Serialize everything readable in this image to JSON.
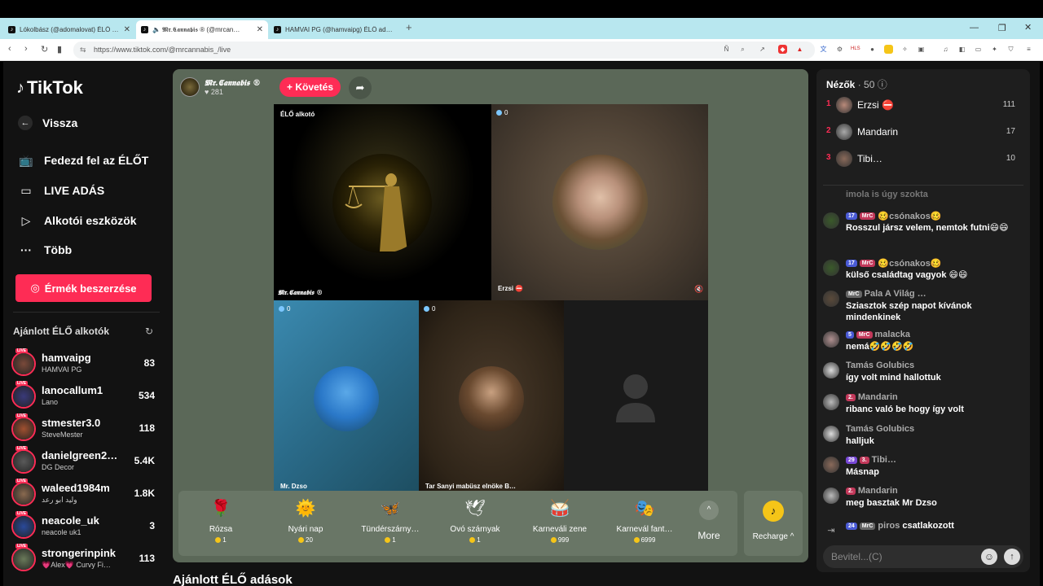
{
  "browser": {
    "tabs": [
      {
        "label": "Lókolbász (@adomalovat) ÉLŐ adás…",
        "active": false
      },
      {
        "label": "🔈 𝕸𝖗.𝕮𝖆𝖓𝖓𝖆𝖇𝖎𝖘 ® (@mrcan…",
        "active": true
      },
      {
        "label": "HAMVAI PG (@hamvaipg) ÉLŐ adás…",
        "active": false
      }
    ],
    "new_tab": "+",
    "url": "https://www.tiktok.com/@mrcannabis_/live"
  },
  "sidebar": {
    "logo": "TikTok",
    "back": "Vissza",
    "nav": [
      {
        "label": "Fedezd fel az ÉLŐT",
        "icon": "explore-live-icon"
      },
      {
        "label": "LIVE ADÁS",
        "icon": "camera-icon"
      },
      {
        "label": "Alkotói eszközök",
        "icon": "creator-tools-icon"
      },
      {
        "label": "Több",
        "icon": "more-dots-icon"
      }
    ],
    "coin_button": "Érmék beszerzése",
    "recommended_title": "Ajánlott ÉLŐ alkotók",
    "live_tag": "LIVE",
    "recommended": [
      {
        "name": "hamvaipg",
        "sub": "HAMVAI PG",
        "count": "83",
        "color": "#7a4a3a"
      },
      {
        "name": "lanocallum1",
        "sub": "Lano",
        "count": "534",
        "color": "#3a3a7a"
      },
      {
        "name": "stmester3.0",
        "sub": "SteveMester",
        "count": "118",
        "color": "#a05030"
      },
      {
        "name": "danielgreen2…",
        "sub": "DG Decor",
        "count": "5.4K",
        "color": "#5a5a5a"
      },
      {
        "name": "waleed1984m",
        "sub": "وليد ابو رعد",
        "count": "1.8K",
        "color": "#8a6a50"
      },
      {
        "name": "neacole_uk",
        "sub": "neacole uk1",
        "count": "3",
        "color": "#2a4a9a"
      },
      {
        "name": "strongerinpink",
        "sub": "💗Alex💗 Curvy Fi…",
        "count": "113",
        "color": "#6a7a5a"
      }
    ]
  },
  "stream": {
    "host_name": "𝕸𝖗.𝕮𝖆𝖓𝖓𝖆𝖇𝖎𝖘 ®",
    "host_likes": "♥ 281",
    "follow": "+ Követés",
    "tiles": {
      "host_badge": "ÉLŐ alkotó",
      "host_label": "𝕸𝖗.𝕮𝖆𝖓𝖓𝖆𝖇𝖎𝖘 ®",
      "erzsi_count": "0",
      "erzsi_label": "Erzsi ⛔",
      "dzso_count": "0",
      "dzso_label": "Mr. Dzso",
      "tar_count": "0",
      "tar_label": "Tar Sanyi mabüsz elnöke B…"
    },
    "gifts": [
      {
        "name": "Rózsa",
        "price": "1",
        "icon": "🌹"
      },
      {
        "name": "Nyári nap",
        "price": "20",
        "icon": "🌞"
      },
      {
        "name": "Tündérszárny…",
        "price": "1",
        "icon": "🦋"
      },
      {
        "name": "Óvó szárnyak",
        "price": "1",
        "icon": "🕊"
      },
      {
        "name": "Karneváli zene",
        "price": "999",
        "icon": "🥁"
      },
      {
        "name": "Karnevál fant…",
        "price": "6999",
        "icon": "🎭"
      }
    ],
    "more": "More",
    "recharge": "Recharge ^"
  },
  "recommended_live_title": "Ajánlott ÉLŐ adások",
  "right": {
    "viewers_title": "Nézők",
    "viewers_count": "· 50",
    "top_viewers": [
      {
        "rank": "1",
        "name": "Erzsi ⛔",
        "score": "111",
        "color": "#b98a7a"
      },
      {
        "rank": "2",
        "name": "Mandarin",
        "score": "17",
        "color": "#aaaaaa"
      },
      {
        "rank": "3",
        "name": "Tibi…",
        "score": "10",
        "color": "#8a6a5a"
      }
    ],
    "messages": [
      {
        "user": "imola is úgy szokta",
        "text": "",
        "badges": [],
        "color": "#555"
      },
      {
        "user": "🥴csónakos🥴",
        "text": "Rosszul jársz velem, nemtok futni😄😄",
        "badges": [
          {
            "t": "17",
            "c": "b-blue"
          },
          {
            "t": "MrC",
            "c": "b-red"
          }
        ],
        "color": "#3a5a2a"
      },
      {
        "user": "🥴csónakos🥴",
        "text": "külső családtag vagyok 😄😄",
        "badges": [
          {
            "t": "17",
            "c": "b-blue"
          },
          {
            "t": "MrC",
            "c": "b-red"
          }
        ],
        "color": "#3a5a2a"
      },
      {
        "user": "Pala A Világ …",
        "text": "Sziasztok szép napot kívánok mindenkinek",
        "badges": [
          {
            "t": "MrC",
            "c": "b-gray"
          }
        ],
        "color": "#5a4a3a"
      },
      {
        "user": "malacka",
        "text": "nemá🤣🤣🤣🤣",
        "badges": [
          {
            "t": "5",
            "c": "b-blue"
          },
          {
            "t": "MrC",
            "c": "b-red"
          }
        ],
        "color": "#b09090"
      },
      {
        "user": "Tamás Golubics",
        "text": "így volt mind hallottuk",
        "badges": [],
        "color": "#dddddd"
      },
      {
        "user": "Mandarin",
        "text": "ribanc való be hogy így volt",
        "badges": [
          {
            "t": "2.",
            "c": "b-red"
          }
        ],
        "color": "#bbbbbb"
      },
      {
        "user": "Tamás Golubics",
        "text": "halljuk",
        "badges": [],
        "color": "#dddddd"
      },
      {
        "user": "Tibi…",
        "text": "Másnap",
        "badges": [
          {
            "t": "29",
            "c": "b-purp"
          },
          {
            "t": "3.",
            "c": "b-red"
          }
        ],
        "color": "#8a6a5a"
      },
      {
        "user": "Mandarin",
        "text": "meg basztak Mr Dzso",
        "badges": [
          {
            "t": "2.",
            "c": "b-red"
          }
        ],
        "color": "#bbbbbb"
      }
    ],
    "join_badges": [
      "24",
      "MrC"
    ],
    "join_user": "piros",
    "join_text": "csatlakozott",
    "input_placeholder": "Bevitel...(C)"
  }
}
